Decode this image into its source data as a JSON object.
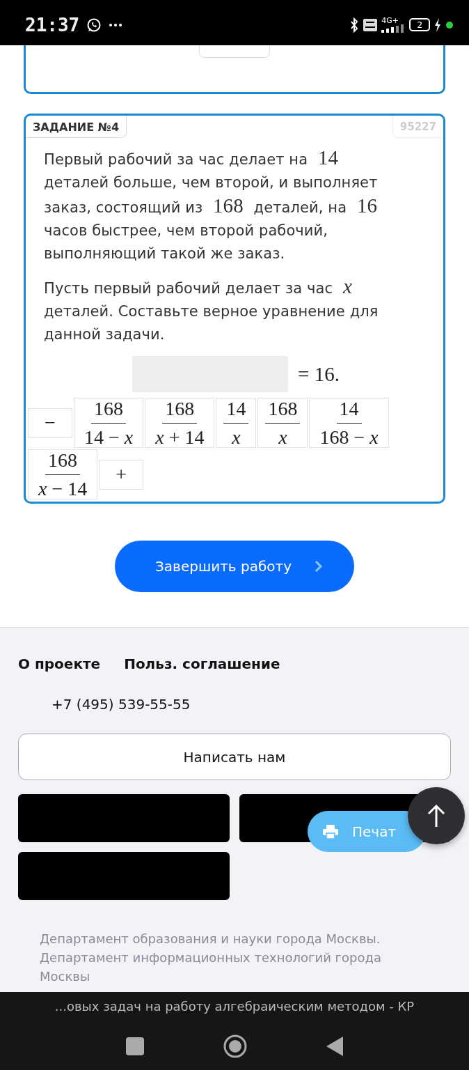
{
  "status_bar": {
    "time": "21:37",
    "network": "4G+",
    "battery": "2"
  },
  "task": {
    "title": "ЗАДАНИЕ №4",
    "number": "95227",
    "paragraphs": [
      [
        {
          "kind": "text",
          "text": "Первый рабочий за час делает на "
        },
        {
          "kind": "math",
          "text": "14"
        },
        {
          "kind": "text",
          "text": " деталей больше, чем второй, и выполняет заказ, состоящий из "
        },
        {
          "kind": "math",
          "text": "168"
        },
        {
          "kind": "text",
          "text": " деталей, на "
        },
        {
          "kind": "math",
          "text": "16"
        },
        {
          "kind": "text",
          "text": " часов быстрее, чем второй рабочий, выполняющий такой же заказ."
        }
      ],
      [
        {
          "kind": "text",
          "text": "Пусть первый рабочий делает за час "
        },
        {
          "kind": "math",
          "text": "*x*"
        },
        {
          "kind": "text",
          "text": " деталей. Составьте верное уравнение для данной задачи."
        }
      ]
    ],
    "equation_rhs": "= 16.",
    "options": [
      {
        "kind": "symbol",
        "text": "−"
      },
      {
        "kind": "fraction",
        "numerator": "168",
        "denominator": "14 − *x*"
      },
      {
        "kind": "fraction",
        "numerator": "168",
        "denominator": "*x* + 14"
      },
      {
        "kind": "fraction",
        "numerator": "14",
        "denominator": "*x*"
      },
      {
        "kind": "fraction",
        "numerator": "168",
        "denominator": "*x*"
      },
      {
        "kind": "fraction",
        "numerator": "14",
        "denominator": "168 − *x*"
      },
      {
        "kind": "fraction",
        "numerator": "168",
        "denominator": "*x* − 14"
      },
      {
        "kind": "symbol",
        "text": "+"
      }
    ]
  },
  "finish_button": {
    "label": "Завершить работу"
  },
  "footer": {
    "links": [
      "О проекте",
      "Польз. соглашение"
    ],
    "phone": "+7 (495) 539-55-55",
    "contact_button": "Написать нам",
    "print_button": "Печат",
    "copyright": "Департамент образования и науки города Москвы. Департамент информационных технологий города Москвы"
  },
  "browser_title": "...овых задач на работу алгебраическим методом - КР"
}
